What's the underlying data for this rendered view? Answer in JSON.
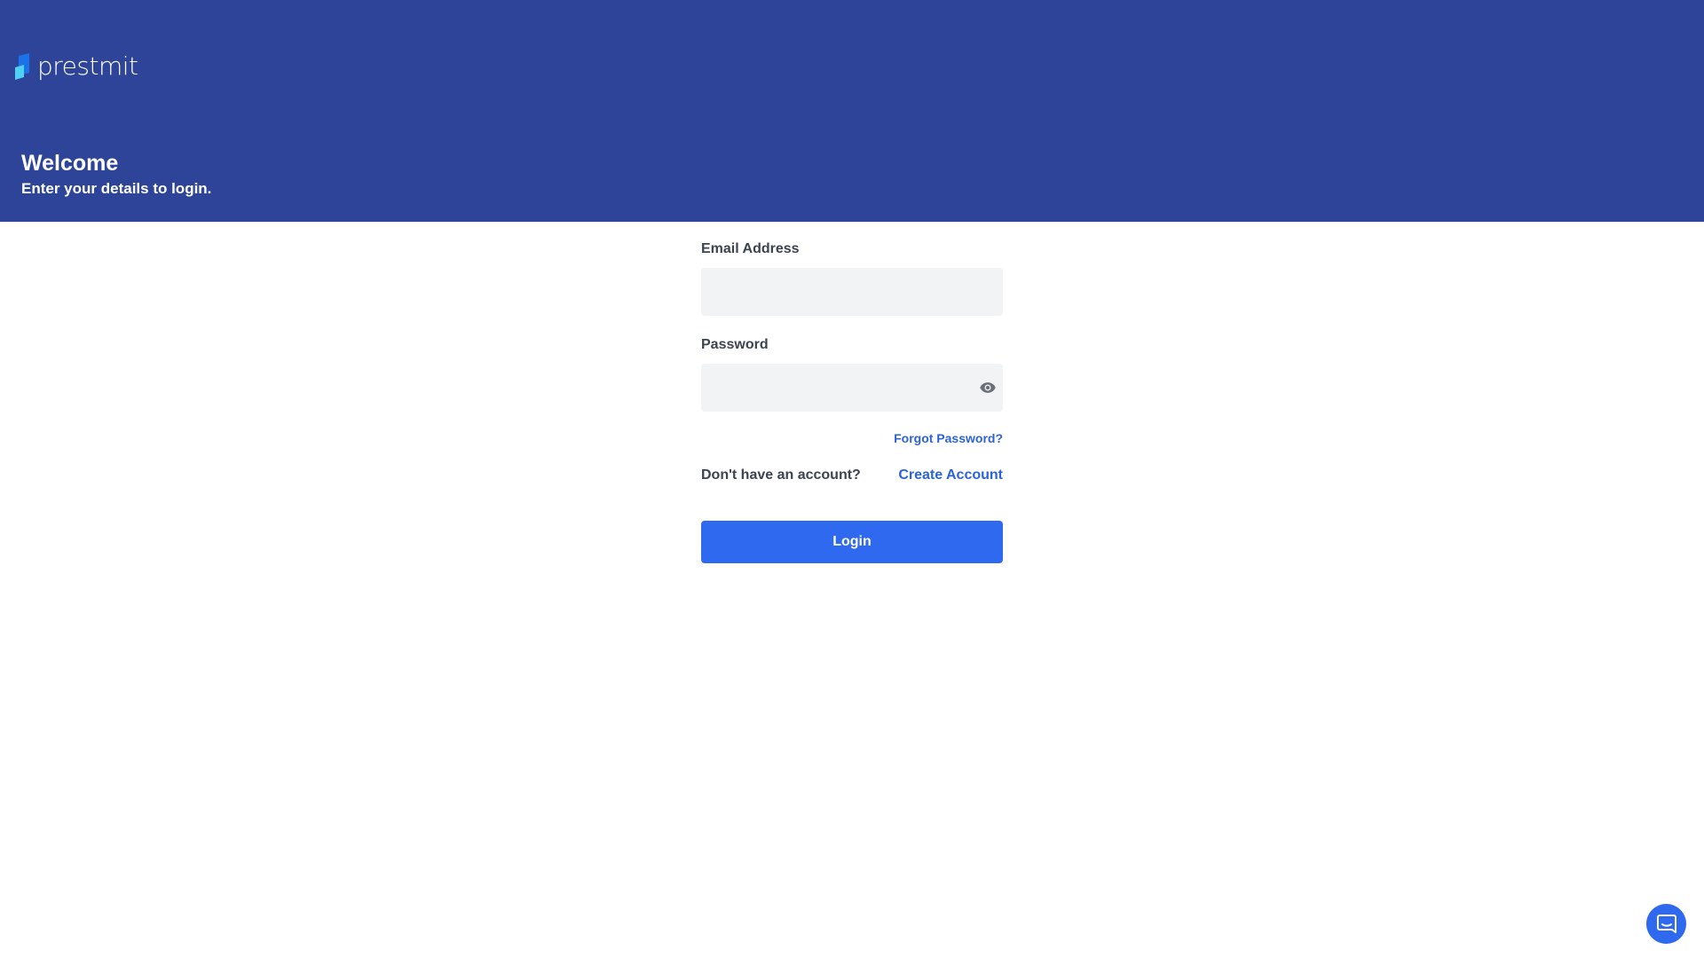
{
  "brand": {
    "name": "prestmit",
    "logo_icon": "prestmit-logo-mark",
    "colors": {
      "header_bg": "#2e4499",
      "primary": "#2f69f0",
      "link": "#2c63d9",
      "logo_mark_dark": "#1a73e8",
      "logo_mark_light": "#4fd1f5"
    }
  },
  "header": {
    "title": "Welcome",
    "subtitle": "Enter your details to login."
  },
  "form": {
    "email": {
      "label": "Email Address",
      "value": "",
      "placeholder": ""
    },
    "password": {
      "label": "Password",
      "value": "",
      "placeholder": "",
      "toggle_icon": "eye-icon"
    },
    "forgot_password": "Forgot Password?",
    "no_account_text": "Don't have an account?",
    "create_account": "Create Account",
    "submit_label": "Login"
  },
  "support": {
    "chat_icon": "chat-bubble-icon"
  }
}
